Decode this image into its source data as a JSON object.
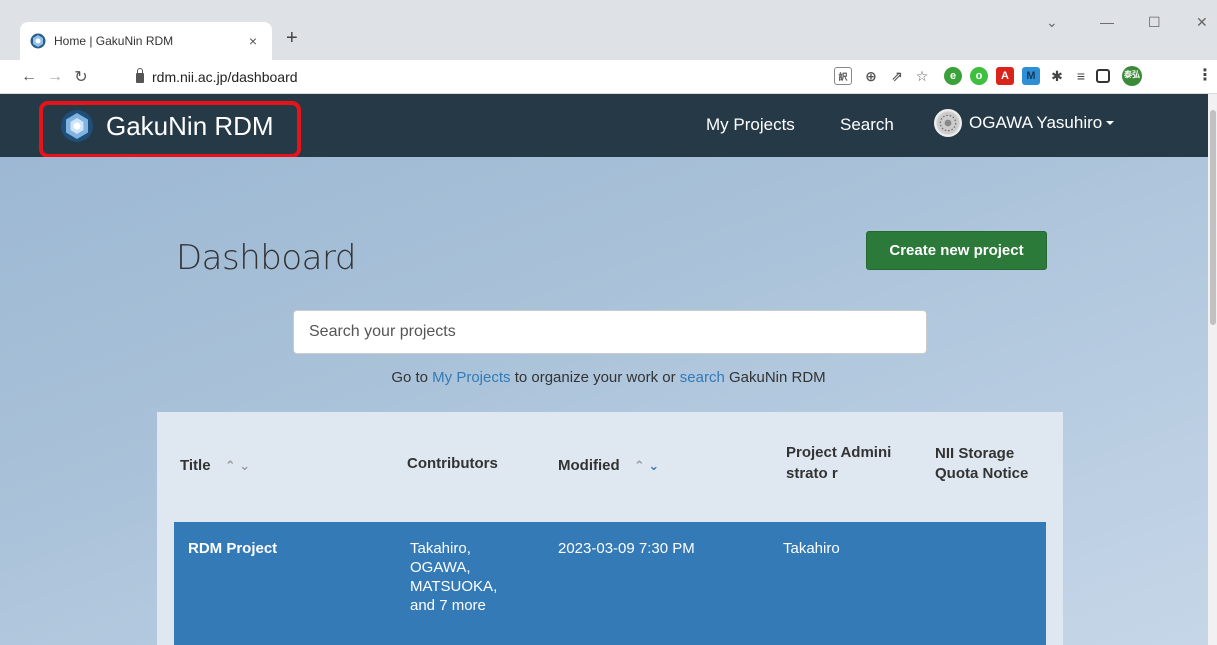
{
  "browser": {
    "tab_title": "Home | GakuNin RDM",
    "tab_close": "×",
    "new_tab": "+",
    "url": "rdm.nii.ac.jp/dashboard"
  },
  "navbar": {
    "brand": "GakuNin RDM",
    "links": [
      "My Projects",
      "Search"
    ],
    "user_name": "OGAWA Yasuhiro"
  },
  "page": {
    "title": "Dashboard",
    "create_button": "Create new project",
    "search_placeholder": "Search your projects",
    "helper": {
      "prefix": "Go to ",
      "link1": "My Projects",
      "middle": " to organize your work or ",
      "link2": "search",
      "suffix": " GakuNin RDM"
    }
  },
  "table": {
    "headers": {
      "title": "Title",
      "contributors": "Contributors",
      "modified": "Modified",
      "admin": "Project Administrato r",
      "quota": "NII Storage Quota Notice"
    },
    "rows": [
      {
        "title": "RDM Project",
        "contributors": "Takahiro, OGAWA, MATSUOKA, and 7 more",
        "modified": "2023-03-09 7:30 PM",
        "admin": "Takahiro",
        "quota": ""
      }
    ]
  },
  "colors": {
    "navbar_bg": "#263947",
    "highlight": "#e8121b",
    "create_button": "#2c7a3a",
    "selected_row": "#337ab7",
    "link": "#337ab7"
  }
}
